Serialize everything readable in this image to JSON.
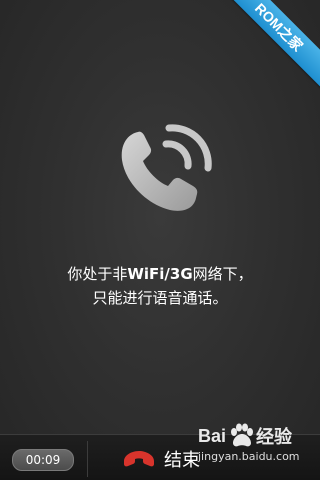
{
  "badge": {
    "text": "ROM之家",
    "color": "#2a9be0"
  },
  "call": {
    "icon": "phone-wifi-call-icon",
    "message_line1_prefix": "你处于非",
    "message_line1_emphasis": "WiFi/3G",
    "message_line1_suffix": "网络下，",
    "message_line2": "只能进行语音通话。"
  },
  "bottom_bar": {
    "timer": "00:09",
    "end_icon": "hang-up-icon",
    "end_label": "结束",
    "end_icon_color": "#d8342c"
  },
  "watermark": {
    "brand_left": "Bai",
    "brand_right": "经验",
    "url": "jingyan.baidu.com"
  }
}
